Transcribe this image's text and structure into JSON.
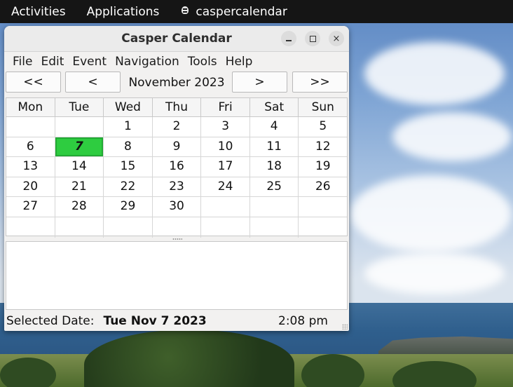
{
  "topbar": {
    "activities": "Activities",
    "applications": "Applications",
    "app_name": "caspercalendar"
  },
  "window": {
    "title": "Casper Calendar",
    "controls": {
      "minimize_icon": "minimize-icon",
      "maximize_icon": "maximize-icon",
      "close_icon": "close-icon",
      "close_glyph": "×"
    }
  },
  "menu": [
    "File",
    "Edit",
    "Event",
    "Navigation",
    "Tools",
    "Help"
  ],
  "nav": {
    "prev_year": "<<",
    "prev_month": "<",
    "month_label": "November 2023",
    "next_month": ">",
    "next_year": ">>"
  },
  "calendar": {
    "weekdays": [
      "Mon",
      "Tue",
      "Wed",
      "Thu",
      "Fri",
      "Sat",
      "Sun"
    ],
    "weeks": [
      [
        "",
        "",
        "1",
        "2",
        "3",
        "4",
        "5"
      ],
      [
        "6",
        "7",
        "8",
        "9",
        "10",
        "11",
        "12"
      ],
      [
        "13",
        "14",
        "15",
        "16",
        "17",
        "18",
        "19"
      ],
      [
        "20",
        "21",
        "22",
        "23",
        "24",
        "25",
        "26"
      ],
      [
        "27",
        "28",
        "29",
        "30",
        "",
        "",
        ""
      ],
      [
        "",
        "",
        "",
        "",
        "",
        "",
        ""
      ]
    ],
    "selected_day": "7",
    "selected_color": "#2ecc40"
  },
  "status": {
    "label": "Selected Date:",
    "date": "Tue Nov 7 2023",
    "time": "2:08 pm"
  }
}
